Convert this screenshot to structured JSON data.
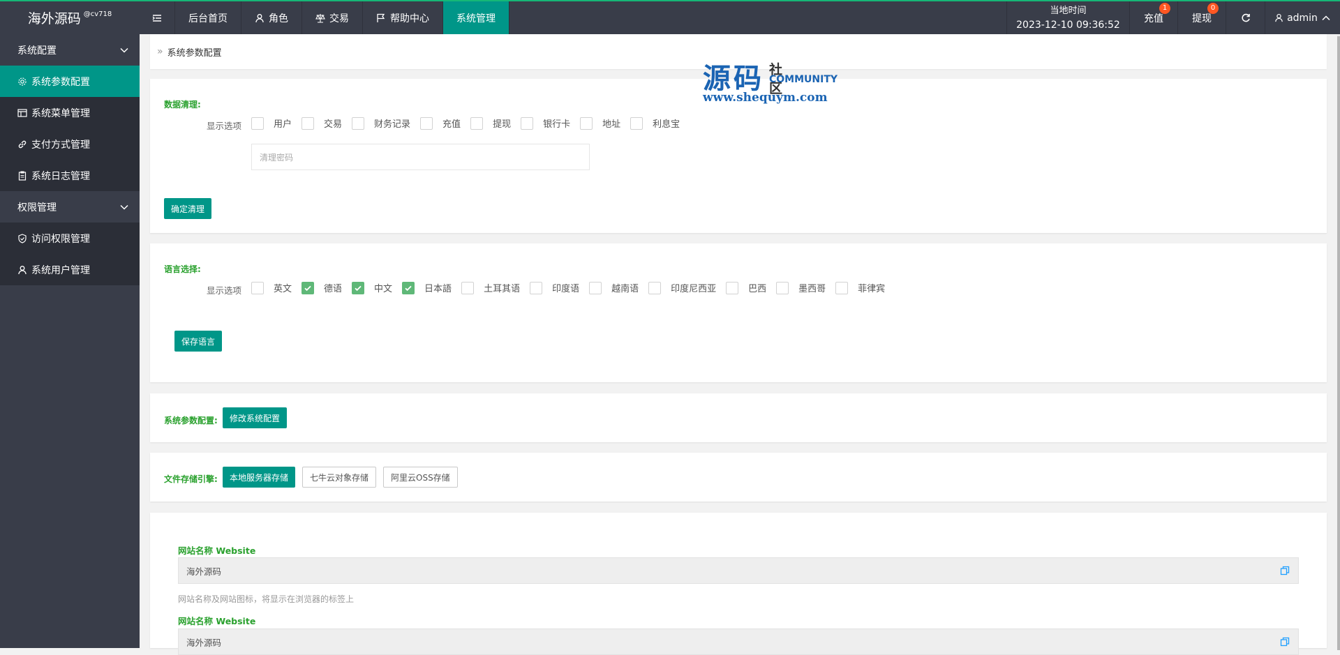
{
  "brand": {
    "name": "海外源码",
    "tag": "@cv718"
  },
  "nav": {
    "home": "后台首页",
    "roles": "角色",
    "trade": "交易",
    "help": "帮助中心",
    "system": "系统管理"
  },
  "header": {
    "time_label": "当地时间",
    "time_value": "2023-12-10 09:36:52",
    "recharge": "充值",
    "recharge_badge": "1",
    "withdraw": "提现",
    "withdraw_badge": "0",
    "user": "admin"
  },
  "sidebar": {
    "group1": "系统配置",
    "items1": [
      "系统参数配置",
      "系统菜单管理",
      "支付方式管理",
      "系统日志管理"
    ],
    "group2": "权限管理",
    "items2": [
      "访问权限管理",
      "系统用户管理"
    ]
  },
  "breadcrumb": "系统参数配置",
  "watermark": {
    "big": "源码",
    "small": "社区",
    "community": "COMMUNITY",
    "url": "www.shequym.com"
  },
  "clean": {
    "title": "数据清理:",
    "label": "显示选项",
    "options": [
      "用户",
      "交易",
      "财务记录",
      "充值",
      "提现",
      "银行卡",
      "地址",
      "利息宝"
    ],
    "password_placeholder": "清理密码",
    "button": "确定清理"
  },
  "language": {
    "title": "语言选择:",
    "label": "显示选项",
    "options": [
      "英文",
      "德语",
      "中文",
      "日本語",
      "土耳其语",
      "印度语",
      "越南语",
      "印度尼西亚",
      "巴西",
      "墨西哥",
      "菲律宾"
    ],
    "checked": [
      false,
      true,
      true,
      true,
      false,
      false,
      false,
      false,
      false,
      false,
      false
    ],
    "button": "保存语言"
  },
  "sysparam": {
    "title": "系统参数配置:",
    "button": "修改系统配置"
  },
  "storage": {
    "title": "文件存储引擎:",
    "options": [
      "本地服务器存储",
      "七牛云对象存储",
      "阿里云OSS存储"
    ]
  },
  "site": {
    "label1": "网站名称 Website",
    "value1": "海外源码",
    "hint1": "网站名称及网站图标，将显示在浏览器的标签上",
    "label2": "网站名称 Website",
    "value2": "海外源码"
  },
  "colors": {
    "accent": "#009688",
    "topbar": "#393d49",
    "green_text": "#2aa12e",
    "badge": "#ff5722"
  }
}
